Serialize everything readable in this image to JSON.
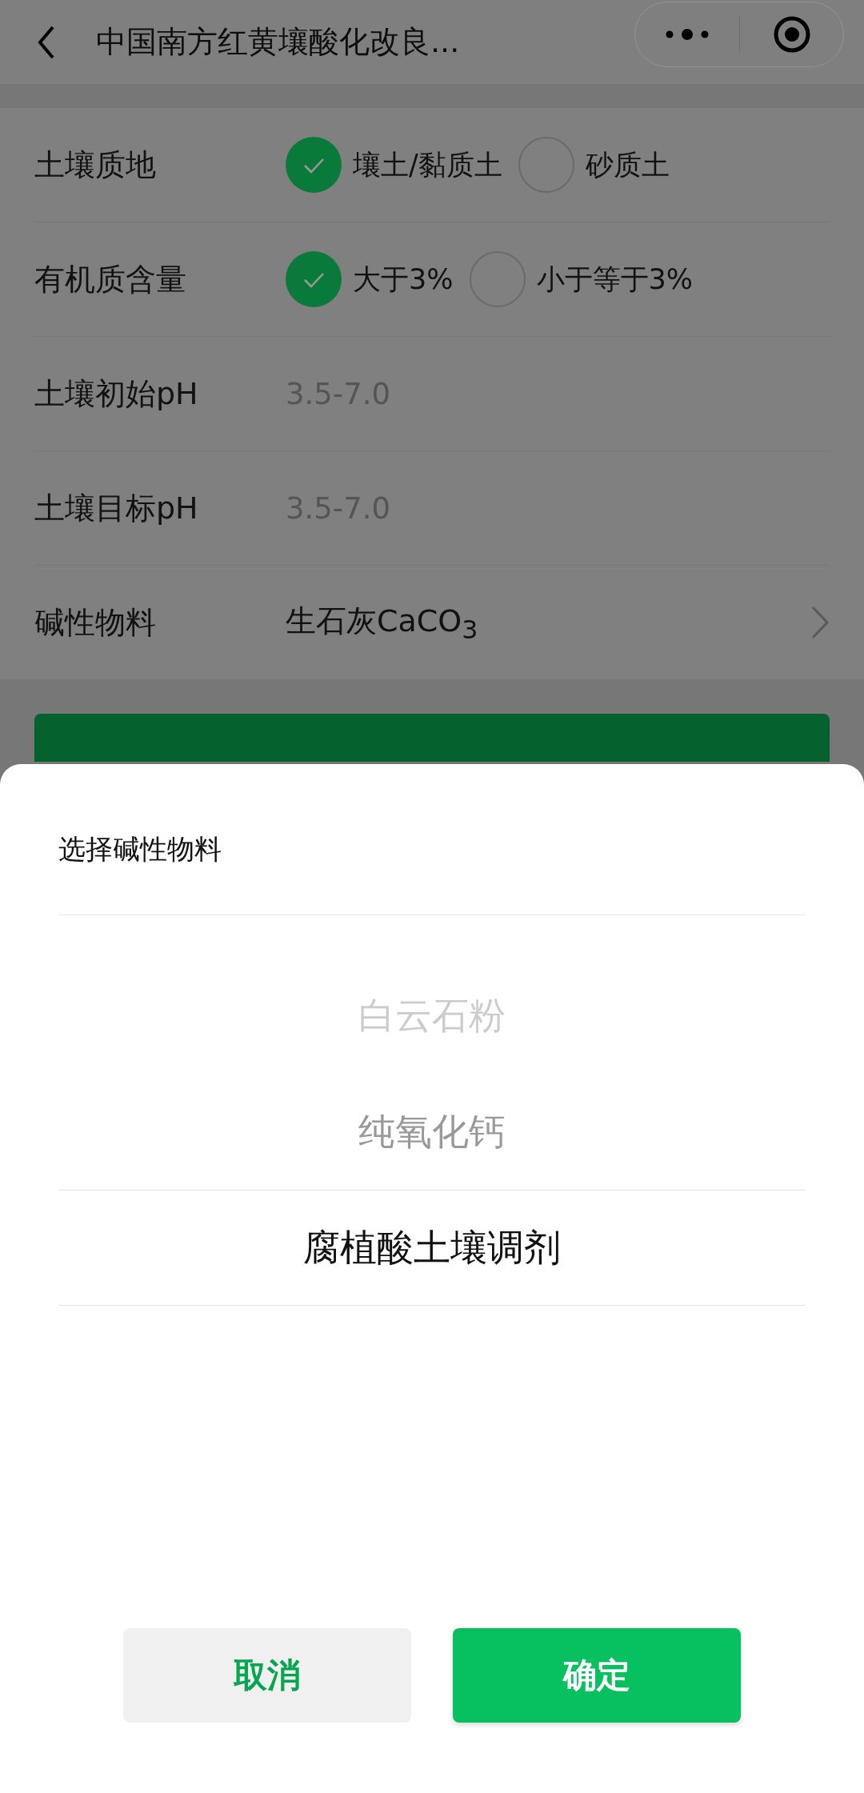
{
  "nav": {
    "title": "中国南方红黄壤酸化改良..."
  },
  "form": {
    "rows": [
      {
        "kind": "radio",
        "label": "土壤质地",
        "options": [
          {
            "label": "壤土/黏质土",
            "selected": true
          },
          {
            "label": "砂质土",
            "selected": false
          }
        ]
      },
      {
        "kind": "radio",
        "label": "有机质含量",
        "options": [
          {
            "label": "大于3%",
            "selected": true
          },
          {
            "label": "小于等于3%",
            "selected": false
          }
        ]
      },
      {
        "kind": "input",
        "label": "土壤初始pH",
        "placeholder": "3.5-7.0"
      },
      {
        "kind": "input",
        "label": "土壤目标pH",
        "placeholder": "3.5-7.0"
      },
      {
        "kind": "select",
        "label": "碱性物料",
        "value": "生石灰CaCO$_{3}$"
      }
    ]
  },
  "picker": {
    "title": "选择碱性物料",
    "options": [
      {
        "label": "白云石粉",
        "selected": false
      },
      {
        "label": "纯氧化钙",
        "selected": false
      },
      {
        "label": "腐植酸土壤调剂",
        "selected": true
      }
    ],
    "buttons": [
      {
        "label": "取消",
        "kind": "cancel"
      },
      {
        "label": "确定",
        "kind": "confirm"
      }
    ]
  }
}
